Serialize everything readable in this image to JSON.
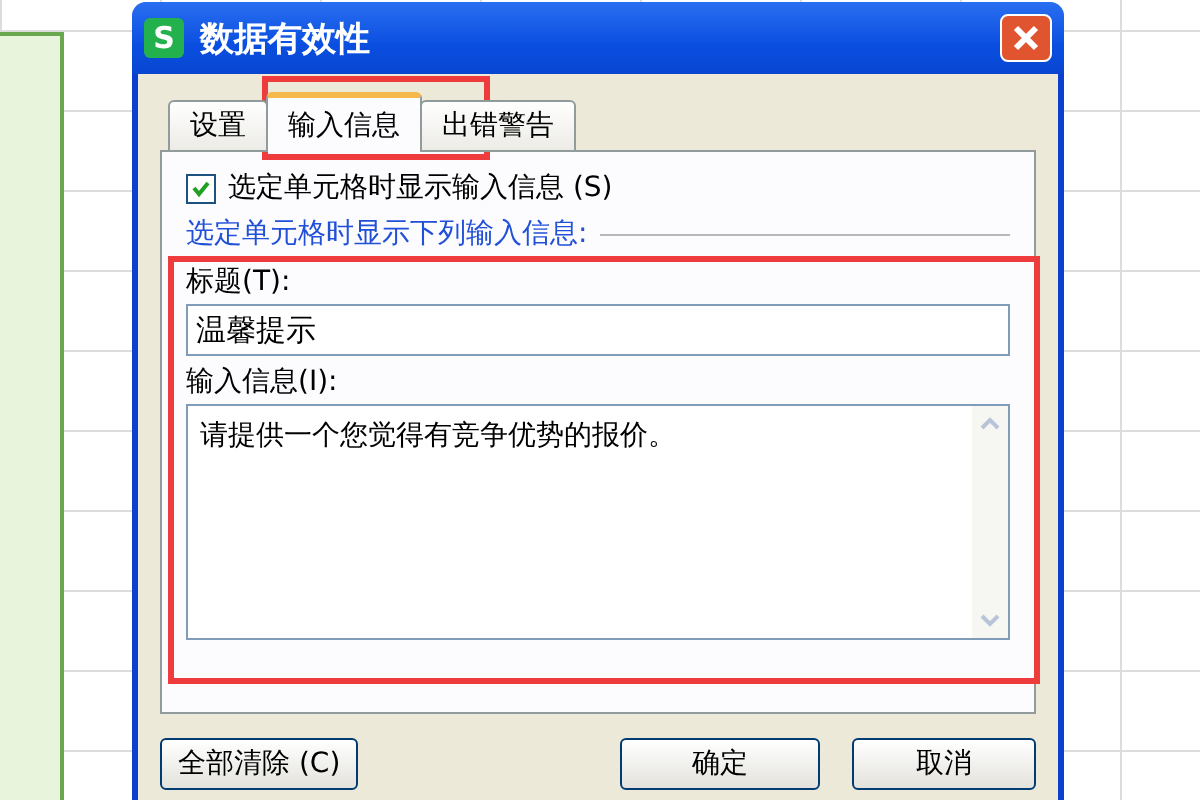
{
  "window": {
    "title": "数据有效性",
    "app_icon": "S"
  },
  "tabs": [
    {
      "label": "设置",
      "selected": false
    },
    {
      "label": "输入信息",
      "selected": true
    },
    {
      "label": "出错警告",
      "selected": false
    }
  ],
  "show_input_message": {
    "label": "选定单元格时显示输入信息 (S)",
    "checked": true
  },
  "group_label": "选定单元格时显示下列输入信息:",
  "title_field": {
    "label": "标题(T):",
    "value": "温馨提示"
  },
  "message_field": {
    "label": "输入信息(I):",
    "value": "请提供一个您觉得有竞争优势的报价。"
  },
  "buttons": [
    {
      "label": "全部清除 (C)"
    },
    {
      "label": "确定"
    },
    {
      "label": "取消"
    }
  ]
}
